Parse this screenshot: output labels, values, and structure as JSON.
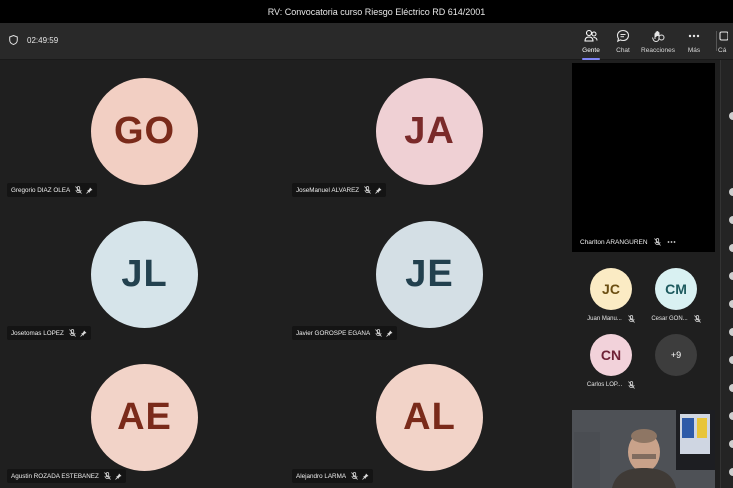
{
  "window": {
    "title": "RV: Convocatoria curso Riesgo Eléctrico RD 614/2001"
  },
  "toolbar": {
    "timer": "02:49:59",
    "people_label": "Gente",
    "chat_label": "Chat",
    "reactions_label": "Reacciones",
    "more_label": "Más",
    "extra_label": "Cá"
  },
  "grid": {
    "participants": [
      {
        "initials": "GO",
        "name": "Gregorio DIAZ OLEA",
        "bg": "#f2cfc3",
        "fg": "#7a2a1a"
      },
      {
        "initials": "JA",
        "name": "JoseManuel ALVAREZ",
        "bg": "#efd0d4",
        "fg": "#7a2a2a"
      },
      {
        "initials": "JL",
        "name": "Josetomas LOPEZ",
        "bg": "#d6e4ea",
        "fg": "#23414f"
      },
      {
        "initials": "JE",
        "name": "Javier GOROSPE EGANA",
        "bg": "#d4dfe5",
        "fg": "#22404e"
      },
      {
        "initials": "AE",
        "name": "Agustin ROZADA ESTEBANEZ",
        "bg": "#f2d3c8",
        "fg": "#7a2a1a"
      },
      {
        "initials": "AL",
        "name": "Alejandro LARMA",
        "bg": "#f2d3c8",
        "fg": "#7a2a1a"
      }
    ]
  },
  "sidebar": {
    "presenter_name": "Charlton ARANGUREN",
    "small": [
      {
        "initials": "JC",
        "name": "Juan Manu...",
        "bg": "#fbebc4",
        "fg": "#6b4e12"
      },
      {
        "initials": "CM",
        "name": "Cesar GON...",
        "bg": "#d9f1f2",
        "fg": "#1d5a5e"
      },
      {
        "initials": "CN",
        "name": "Carlos LOP...",
        "bg": "#f2d2da",
        "fg": "#6e2236"
      },
      {
        "initials": "+9",
        "name": "",
        "bg": "#3d3d3d",
        "fg": "#ffffff"
      }
    ]
  },
  "colors": {
    "accent": "#7f85f5",
    "stage_bg": "#1f1f1f",
    "toolbar_bg": "#292929"
  }
}
